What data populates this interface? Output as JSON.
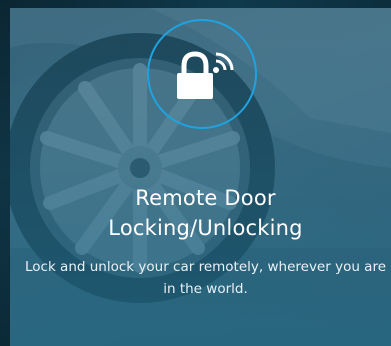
{
  "feature": {
    "title_line1": "Remote Door",
    "title_line2": "Locking/Unlocking",
    "description": "Lock and unlock your car remotely, wherever you are in the world.",
    "icon": "lock-wireless-icon"
  },
  "colors": {
    "accent": "#1fa3e0",
    "overlay": "#1a6a8a",
    "text": "#ffffff"
  }
}
